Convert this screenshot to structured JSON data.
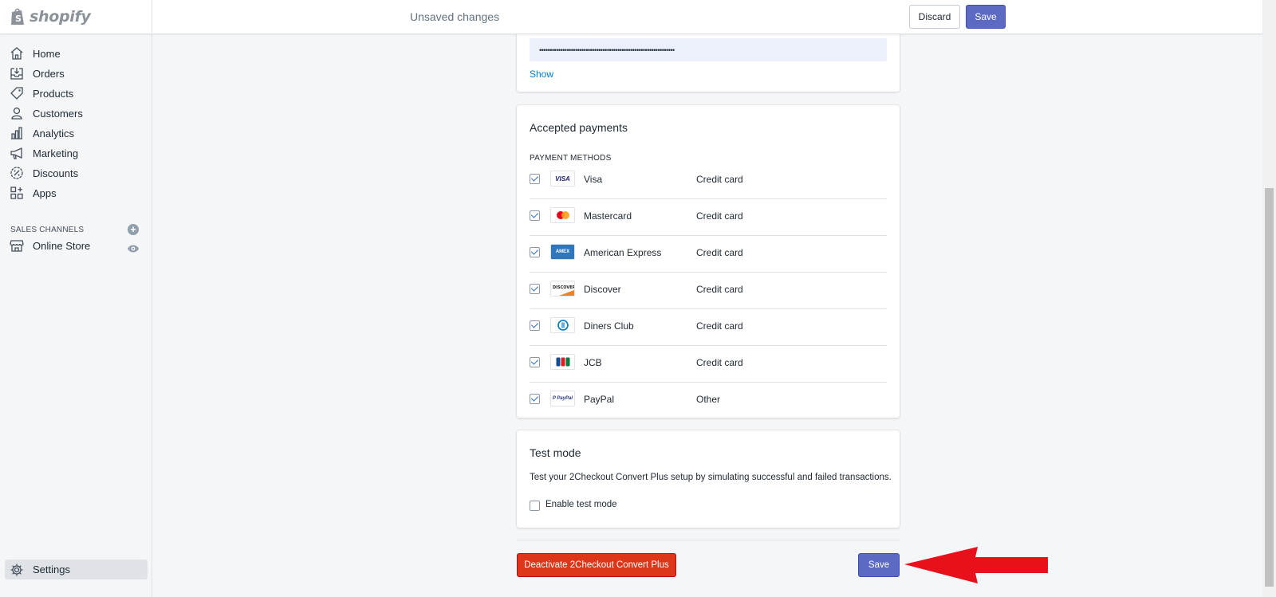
{
  "brand": {
    "name": "shopify"
  },
  "topbar": {
    "status": "Unsaved changes",
    "discard_label": "Discard",
    "save_label": "Save"
  },
  "sidebar": {
    "items": [
      {
        "label": "Home",
        "icon": "home-icon"
      },
      {
        "label": "Orders",
        "icon": "orders-icon"
      },
      {
        "label": "Products",
        "icon": "tag-icon"
      },
      {
        "label": "Customers",
        "icon": "person-icon"
      },
      {
        "label": "Analytics",
        "icon": "bar-chart-icon"
      },
      {
        "label": "Marketing",
        "icon": "megaphone-icon"
      },
      {
        "label": "Discounts",
        "icon": "discount-icon"
      },
      {
        "label": "Apps",
        "icon": "apps-icon"
      }
    ],
    "sales_channels_header": "SALES CHANNELS",
    "online_store_label": "Online Store",
    "settings_label": "Settings"
  },
  "credentials": {
    "password_value": "••••••••••••••••••••••••••••••••••••••••••••••••••••••••••••••••",
    "show_label": "Show"
  },
  "payments": {
    "title": "Accepted payments",
    "caption": "PAYMENT METHODS",
    "methods": [
      {
        "name": "Visa",
        "type": "Credit card",
        "checked": true,
        "logo": "visa-logo"
      },
      {
        "name": "Mastercard",
        "type": "Credit card",
        "checked": true,
        "logo": "mastercard-logo"
      },
      {
        "name": "American Express",
        "type": "Credit card",
        "checked": true,
        "logo": "amex-logo"
      },
      {
        "name": "Discover",
        "type": "Credit card",
        "checked": true,
        "logo": "discover-logo"
      },
      {
        "name": "Diners Club",
        "type": "Credit card",
        "checked": true,
        "logo": "diners-logo"
      },
      {
        "name": "JCB",
        "type": "Credit card",
        "checked": true,
        "logo": "jcb-logo"
      },
      {
        "name": "PayPal",
        "type": "Other",
        "checked": true,
        "logo": "paypal-logo"
      }
    ]
  },
  "test_mode": {
    "title": "Test mode",
    "description": "Test your 2Checkout Convert Plus setup by simulating successful and failed transactions.",
    "checkbox_label": "Enable test mode",
    "checked": false
  },
  "footer": {
    "deactivate_label": "Deactivate 2Checkout Convert Plus",
    "save_label": "Save"
  },
  "colors": {
    "primary": "#5c6ac4",
    "danger": "#de3618",
    "annotation_arrow": "#e8101a",
    "link": "#007ace"
  }
}
